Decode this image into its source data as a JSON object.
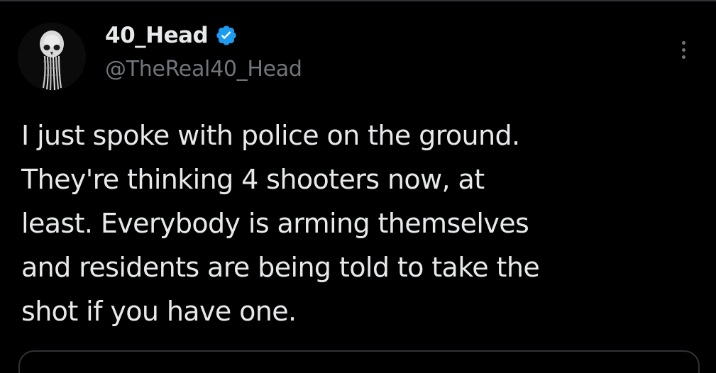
{
  "tweet": {
    "display_name": "40_Head",
    "handle": "@TheReal40_Head",
    "verified": true,
    "body_lines": [
      "I just spoke with police on the ground.",
      "They're thinking 4 shooters now, at",
      "least. Everybody is arming themselves",
      "and residents are being told to take the",
      "shot if you have one."
    ]
  },
  "icons": {
    "verified": "verified-badge-icon",
    "more": "more-options-icon",
    "avatar": "skull-avatar-image"
  },
  "colors": {
    "background": "#000000",
    "text_primary": "#e7e9ea",
    "text_secondary": "#71767b",
    "verified_blue": "#1d9bf0",
    "border": "#2f3336"
  }
}
